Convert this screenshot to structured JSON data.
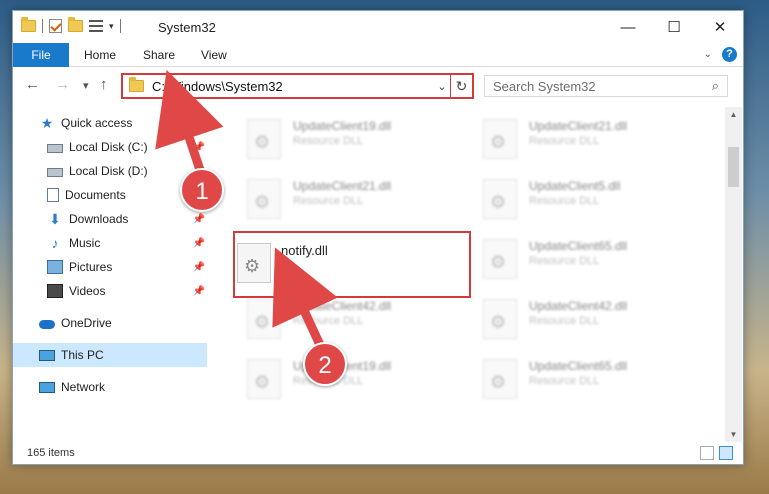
{
  "window": {
    "title": "System32",
    "controls": {
      "minimize": "—",
      "maximize": "☐",
      "close": "✕"
    }
  },
  "ribbon": {
    "tabs": [
      "File",
      "Home",
      "Share",
      "View"
    ],
    "help": "?"
  },
  "nav": {
    "back": "←",
    "forward": "→",
    "recent": "▾",
    "up": "↑"
  },
  "address": {
    "path": "C:\\Windows\\System32",
    "refresh": "↻"
  },
  "search": {
    "placeholder": "Search System32",
    "icon": "⌕"
  },
  "navpane": {
    "items": [
      {
        "label": "Quick access",
        "icon": "star-icon",
        "pinned": false
      },
      {
        "label": "Local Disk (C:)",
        "icon": "drive-icon",
        "pinned": true
      },
      {
        "label": "Local Disk (D:)",
        "icon": "drive-icon",
        "pinned": false
      },
      {
        "label": "Documents",
        "icon": "documents-icon",
        "pinned": false
      },
      {
        "label": "Downloads",
        "icon": "downloads-icon",
        "pinned": true
      },
      {
        "label": "Music",
        "icon": "music-icon",
        "pinned": true
      },
      {
        "label": "Pictures",
        "icon": "pictures-icon",
        "pinned": true
      },
      {
        "label": "Videos",
        "icon": "videos-icon",
        "pinned": true
      },
      {
        "label": "OneDrive",
        "icon": "onedrive-icon",
        "pinned": false
      },
      {
        "label": "This PC",
        "icon": "computer-icon",
        "pinned": false,
        "selected": true
      },
      {
        "label": "Network",
        "icon": "network-icon",
        "pinned": false
      }
    ]
  },
  "files": {
    "highlighted": {
      "name": "notify.dll"
    },
    "background": [
      {
        "name": "UpdateClient19.dll",
        "type": "Resource DLL"
      },
      {
        "name": "UpdateClient21.dll",
        "type": "Resource DLL"
      },
      {
        "name": "UpdateClient21.dll",
        "type": "Resource DLL"
      },
      {
        "name": "UpdateClient5.dll",
        "type": "Resource DLL"
      },
      {
        "name": "UpdateClient65.dll",
        "type": "Resource DLL"
      },
      {
        "name": "UpdateClient42.dll",
        "type": "Resource DLL"
      },
      {
        "name": "UpdateClient42.dll",
        "type": "Resource DLL"
      },
      {
        "name": "UpdateClient19.dll",
        "type": "Resource DLL"
      },
      {
        "name": "UpdateClient65.dll",
        "type": "Resource DLL"
      }
    ]
  },
  "status": {
    "item_count": "165 items"
  },
  "callouts": {
    "step1": "1",
    "step2": "2"
  },
  "colors": {
    "accent": "#1979ca",
    "highlight": "#d03c3c",
    "selected": "#cce8ff"
  }
}
